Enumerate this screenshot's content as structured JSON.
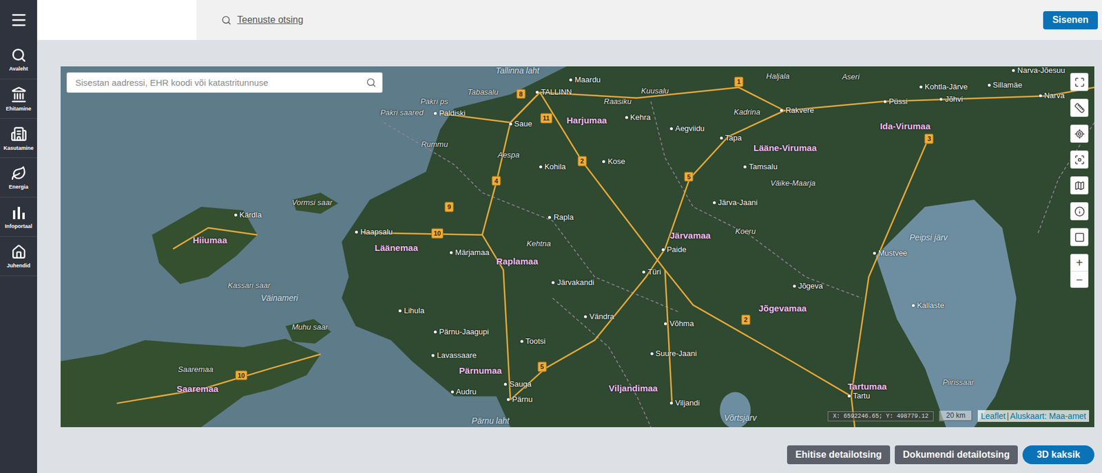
{
  "header": {
    "search_link": "Teenuste otsing",
    "login_button": "Sisenen"
  },
  "sidebar": {
    "items": [
      {
        "label": "Avaleht",
        "selected": false
      },
      {
        "label": "Ehitamine",
        "selected": false
      },
      {
        "label": "Kasutamine",
        "selected": false
      },
      {
        "label": "Energia",
        "selected": false
      },
      {
        "label": "Infoportaal",
        "selected": false
      },
      {
        "label": "Juhendid",
        "selected": false
      }
    ]
  },
  "map": {
    "search_placeholder": "Sisestan aadressi, EHR koodi või katastritunnuse",
    "labels": [
      {
        "text": "Tallinna laht",
        "kind": "water"
      },
      {
        "text": "Maardu",
        "kind": "town"
      },
      {
        "text": "Tabasalu",
        "kind": "place"
      },
      {
        "text": "TALLINN",
        "kind": "town"
      },
      {
        "text": "Kuusalu",
        "kind": "place"
      },
      {
        "text": "Haljala",
        "kind": "place"
      },
      {
        "text": "Aseri",
        "kind": "place"
      },
      {
        "text": "Narva-Jõesuu",
        "kind": "town"
      },
      {
        "text": "Kohtla-Järve",
        "kind": "town"
      },
      {
        "text": "Sillamäe",
        "kind": "town"
      },
      {
        "text": "Narva",
        "kind": "town"
      },
      {
        "text": "Pakri ps",
        "kind": "place"
      },
      {
        "text": "Raasiku",
        "kind": "place"
      },
      {
        "text": "Püssi",
        "kind": "town"
      },
      {
        "text": "Jõhvi",
        "kind": "town"
      },
      {
        "text": "Pakri saared",
        "kind": "place"
      },
      {
        "text": "Paldiski",
        "kind": "town"
      },
      {
        "text": "Rakvere",
        "kind": "town"
      },
      {
        "text": "Kadrina",
        "kind": "place"
      },
      {
        "text": "Kehra",
        "kind": "town"
      },
      {
        "text": "Harjumaa",
        "kind": "county"
      },
      {
        "text": "Saue",
        "kind": "town"
      },
      {
        "text": "Ida-Virumaa",
        "kind": "county"
      },
      {
        "text": "Aegviidu",
        "kind": "town"
      },
      {
        "text": "Tapa",
        "kind": "town"
      },
      {
        "text": "Rummu",
        "kind": "place"
      },
      {
        "text": "Lääne-Virumaa",
        "kind": "county"
      },
      {
        "text": "Aespa",
        "kind": "place"
      },
      {
        "text": "Kose",
        "kind": "town"
      },
      {
        "text": "Kohila",
        "kind": "town"
      },
      {
        "text": "Tamsalu",
        "kind": "town"
      },
      {
        "text": "Väike-Maarja",
        "kind": "place"
      },
      {
        "text": "Vormsi saar",
        "kind": "place"
      },
      {
        "text": "Järva-Jaani",
        "kind": "town"
      },
      {
        "text": "Kärdla",
        "kind": "town"
      },
      {
        "text": "Rapla",
        "kind": "town"
      },
      {
        "text": "Haapsalu",
        "kind": "town"
      },
      {
        "text": "Koeru",
        "kind": "place"
      },
      {
        "text": "Järvamaa",
        "kind": "county"
      },
      {
        "text": "Peipsi järv",
        "kind": "water"
      },
      {
        "text": "Hiiumaa",
        "kind": "county"
      },
      {
        "text": "Kehtna",
        "kind": "place"
      },
      {
        "text": "Läänemaa",
        "kind": "county"
      },
      {
        "text": "Paide",
        "kind": "town"
      },
      {
        "text": "Märjamaa",
        "kind": "town"
      },
      {
        "text": "Mustvee",
        "kind": "town"
      },
      {
        "text": "Raplamaa",
        "kind": "county"
      },
      {
        "text": "Türi",
        "kind": "town"
      },
      {
        "text": "Järvakandi",
        "kind": "town"
      },
      {
        "text": "Kassari saar",
        "kind": "place"
      },
      {
        "text": "Jõgeva",
        "kind": "town"
      },
      {
        "text": "Väinameri",
        "kind": "water"
      },
      {
        "text": "Kallaste",
        "kind": "town"
      },
      {
        "text": "Jõgevamaa",
        "kind": "county"
      },
      {
        "text": "Lihula",
        "kind": "town"
      },
      {
        "text": "Vändra",
        "kind": "town"
      },
      {
        "text": "Võhma",
        "kind": "town"
      },
      {
        "text": "Muhu saar",
        "kind": "place"
      },
      {
        "text": "Pärnu-Jaagupi",
        "kind": "town"
      },
      {
        "text": "Tootsi",
        "kind": "town"
      },
      {
        "text": "Suure-Jaani",
        "kind": "town"
      },
      {
        "text": "Lavassaare",
        "kind": "town"
      },
      {
        "text": "Saaremaa",
        "kind": "place"
      },
      {
        "text": "Pärnumaa",
        "kind": "county"
      },
      {
        "text": "Piirissaar",
        "kind": "place"
      },
      {
        "text": "Sauga",
        "kind": "town"
      },
      {
        "text": "Tartumaa",
        "kind": "county"
      },
      {
        "text": "Viljandimaa",
        "kind": "county"
      },
      {
        "text": "Saaremaa",
        "kind": "county"
      },
      {
        "text": "Audru",
        "kind": "town"
      },
      {
        "text": "Tartu",
        "kind": "town"
      },
      {
        "text": "Pärnu",
        "kind": "town"
      },
      {
        "text": "Viljandi",
        "kind": "town"
      },
      {
        "text": "Võrtsjärv",
        "kind": "water"
      },
      {
        "text": "Pärnu laht",
        "kind": "water"
      },
      {
        "text": "1",
        "kind": "road"
      },
      {
        "text": "8",
        "kind": "road"
      },
      {
        "text": "11",
        "kind": "road"
      },
      {
        "text": "3",
        "kind": "road"
      },
      {
        "text": "2",
        "kind": "road"
      },
      {
        "text": "5",
        "kind": "road"
      },
      {
        "text": "4",
        "kind": "road"
      },
      {
        "text": "9",
        "kind": "road"
      },
      {
        "text": "10",
        "kind": "road"
      },
      {
        "text": "10",
        "kind": "road"
      },
      {
        "text": "5",
        "kind": "road"
      },
      {
        "text": "2",
        "kind": "road"
      }
    ],
    "zoom": {
      "in": "+",
      "out": "−"
    },
    "coordinates": "X: 6592246.65; Y: 498779.12",
    "scale": "20 km",
    "attribution": {
      "library": "Leaflet",
      "separator": "|",
      "base_map": "Aluskaart: Maa-amet"
    }
  },
  "actions": [
    {
      "label": "Ehitise detailotsing",
      "kind": "secondary"
    },
    {
      "label": "Dokumendi detailotsing",
      "kind": "secondary"
    },
    {
      "label": "3D kaksik",
      "kind": "primary"
    }
  ]
}
